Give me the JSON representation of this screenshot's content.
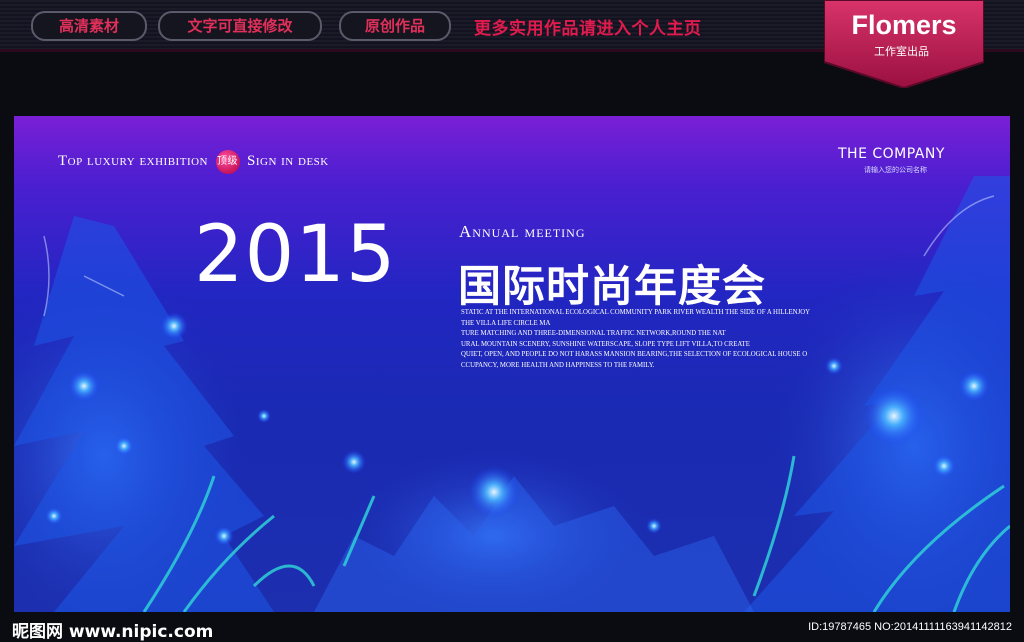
{
  "top_bar": {
    "pills": [
      "高清素材",
      "文字可直接修改",
      "原创作品"
    ],
    "promo": "更多实用作品请进入个人主页",
    "brand": {
      "name": "Flomers",
      "subtitle": "工作室出品"
    }
  },
  "banner": {
    "tag_left": {
      "part1": "Top luxury exhibition",
      "badge": "顶级",
      "part2": "Sign in desk"
    },
    "company": {
      "name": "THE COMPANY",
      "subtitle": "请输入您的公司名称"
    },
    "year": "2015",
    "annual": "Annual meeting",
    "title_cn": "国际时尚年度会",
    "description": [
      "STATIC AT THE INTERNATIONAL ECOLOGICAL COMMUNITY PARK RIVER WEALTH THE SIDE OF A HILLENJOY",
      "THE VILLA LIFE CIRCLE MA",
      "TURE MATCHING AND THREE-DIMENSIONAL TRAFFIC NETWORK,ROUND THE NAT",
      "URAL MOUNTAIN SCENERY, SUNSHINE WATERSCAPE, SLOPE TYPE LIFT VILLA,TO CREATE",
      "QUIET, OPEN, AND PEOPLE DO NOT HARASS MANSION BEARING,THE SELECTION OF ECOLOGICAL HOUSE O",
      "CCUPANCY, MORE HEALTH AND HAPPINESS TO THE FAMILY."
    ],
    "colors": {
      "bg_top": "#7a1fd6",
      "bg_bottom": "#1c2fae",
      "glow": "#4db8ff",
      "accent_cyan": "#2fd0d8"
    }
  },
  "footer": {
    "watermark_left": "昵图网 www.nipic.com",
    "watermark_right": "ID:19787465 NO:20141111163941142812"
  }
}
